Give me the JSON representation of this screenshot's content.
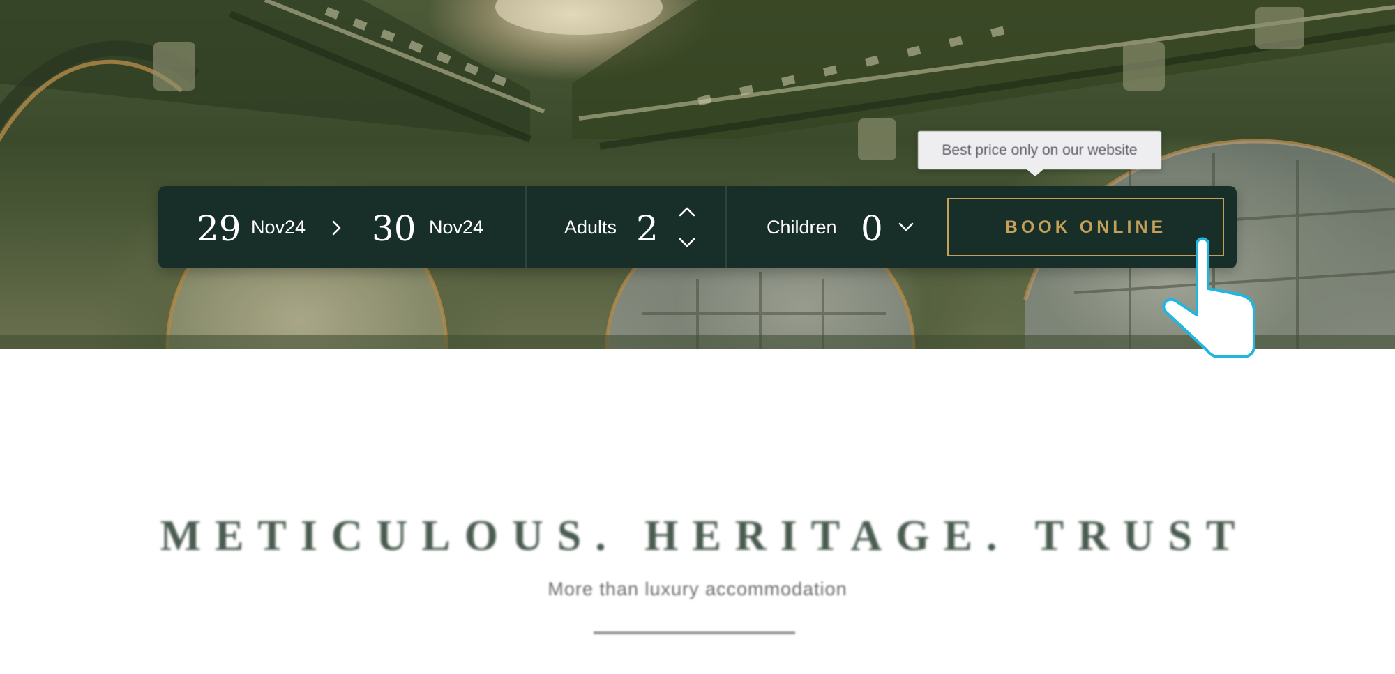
{
  "booking": {
    "checkin_day": "29",
    "checkin_month": "Nov24",
    "checkout_day": "30",
    "checkout_month": "Nov24",
    "adults_label": "Adults",
    "adults_value": "2",
    "children_label": "Children",
    "children_value": "0",
    "book_button": "BOOK ONLINE"
  },
  "tooltip": {
    "text": "Best price only on our website"
  },
  "intro": {
    "headline": "METICULOUS. HERITAGE. TRUST",
    "subheadline": "More than luxury accommodation"
  },
  "colors": {
    "bar_background": "#182e28",
    "accent_gold": "#c4a159",
    "headline": "#4a5c50",
    "cursor_outline": "#1fb6e0"
  },
  "icons": {
    "date_separator": "chevron-right-icon",
    "adults_increment": "chevron-up-icon",
    "adults_decrement": "chevron-down-icon",
    "children_dropdown": "chevron-down-icon",
    "pointer": "hand-pointer-icon"
  }
}
